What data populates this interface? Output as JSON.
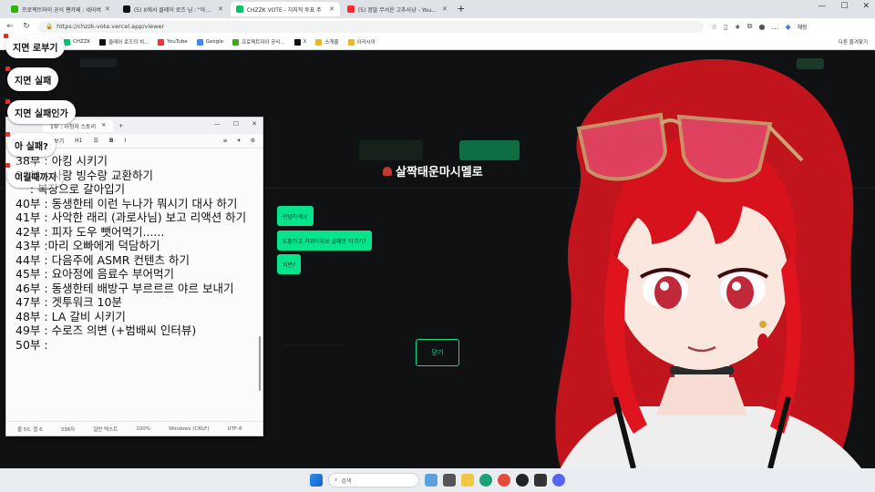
{
  "browser": {
    "tabs": [
      {
        "label": "프로젝트마이 공식 팬카페 : 네이버",
        "color": "#2db400",
        "active": false
      },
      {
        "label": "(5) X에서 클레어 로즈 님 : \"아니 ...",
        "color": "#111111",
        "active": false
      },
      {
        "label": "CHZZK VOTE - 치지직 투표 주",
        "color": "#06c46a",
        "active": true
      },
      {
        "label": "(5) 정말 무서운 고추사냥 - YouTube",
        "color": "#ff2a2a",
        "active": false
      }
    ],
    "url": "https://chzzk-vote.vercel.app/viewer",
    "chat_button": "채팅",
    "bookmarks": [
      {
        "label": "CHZZK",
        "color": "#06c46a"
      },
      {
        "label": "클레어 로즈의 치...",
        "color": "#111111"
      },
      {
        "label": "YouTube",
        "color": "#ff2a2a"
      },
      {
        "label": "Google",
        "color": "#4285f4"
      },
      {
        "label": "프로젝트마이 공식...",
        "color": "#2db400"
      },
      {
        "label": "X",
        "color": "#111111"
      },
      {
        "label": "스캐줄",
        "color": "#f0b429"
      },
      {
        "label": "아카시아",
        "color": "#f0b429"
      }
    ],
    "bookmarks_right": "다른 즐겨찾기"
  },
  "overlay_chat": [
    "지면 로부기",
    "지면 실패",
    "지면 실패인가",
    "아 실패?",
    "이길때까지"
  ],
  "modal": {
    "title": "살짝태운마시멜로",
    "messages": [
      "안녕하세요",
      "도황하고 가위바위보 실패한 이기기?",
      "지면?"
    ],
    "close_label": "닫기"
  },
  "notepad": {
    "tab_title": "1부 : 시청자 스토리",
    "toolbar": {
      "file": "파일",
      "edit": "편집",
      "view": "보기",
      "heading": "H1",
      "bold": "B",
      "italic": "I"
    },
    "lines": [
      "38부 : 아킹 시키기",
      "39부 : 사랑 빙수랑 교환하기",
      "    : 복장으로 갈아입기",
      "40부 : 동생한테 이런 누나가 뭐시기 대사 하기",
      "41부 : 사악한 래리 (과로사님) 보고 리액션 하기",
      "42부 : 피자 도우 뺏어먹기......",
      "43부 :마리 오빠에게 덕담하기",
      "44부 : 다음주에 ASMR 컨텐츠 하기",
      "45부 : 요아정에 음료수 부어먹기",
      "46부 : 동생한테 배방구 부르르르 야르 보내기",
      "47부 : 겟투워크 10분",
      "48부 : LA 갈비 시키기",
      "49부 : 수로즈 의변 (+범배씨 인터뷰)",
      "50부 :"
    ],
    "status": {
      "position": "줄 50, 열 6",
      "chars": "336자",
      "format": "일반 텍스트",
      "zoom": "100%",
      "eol": "Windows (CRLF)",
      "encoding": "UTF-8"
    }
  },
  "taskbar": {
    "search_placeholder": "검색"
  }
}
